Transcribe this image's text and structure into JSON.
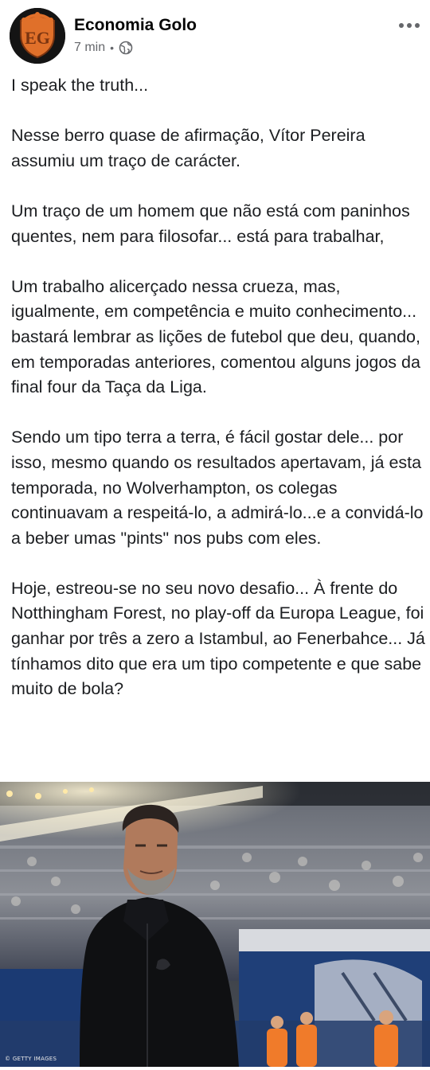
{
  "post": {
    "author": "Economia Golo",
    "time": "7 min",
    "separator": "•",
    "privacy_icon": "globe-icon",
    "avatar_logo_text": "EG",
    "paragraphs": [
      "I speak the truth...",
      "Nesse berro quase de afirmação, Vítor Pereira assumiu um traço de carácter.",
      "Um traço de um homem que não está com paninhos quentes, nem para filosofar... está para trabalhar,",
      "Um trabalho alicerçado nessa crueza, mas, igualmente, em competência e muito conhecimento... bastará lembrar as lições de futebol que deu, quando, em temporadas anteriores, comentou alguns jogos da final four da Taça da Liga.",
      "Sendo um tipo terra a terra, é fácil gostar dele... por isso, mesmo quando os resultados apertavam, já esta temporada, no Wolverhampton, os colegas continuavam a respeitá-lo, a admirá-lo...e a convidá-lo a beber umas \"pints\" nos pubs com eles.",
      "Hoje, estreou-se no seu novo desafio... À frente do Notthingham Forest, no play-off da Europa League, foi ganhar por três a zero a Istambul, ao Fenerbahce... Já tínhamos dito que era um tipo competente e que sabe muito de bola?"
    ],
    "photo_credit": "© GETTY IMAGES"
  },
  "colors": {
    "text": "#1c1e21",
    "meta": "#65676b",
    "avatar_bg": "#141414",
    "logo_orange": "#e0702a"
  }
}
